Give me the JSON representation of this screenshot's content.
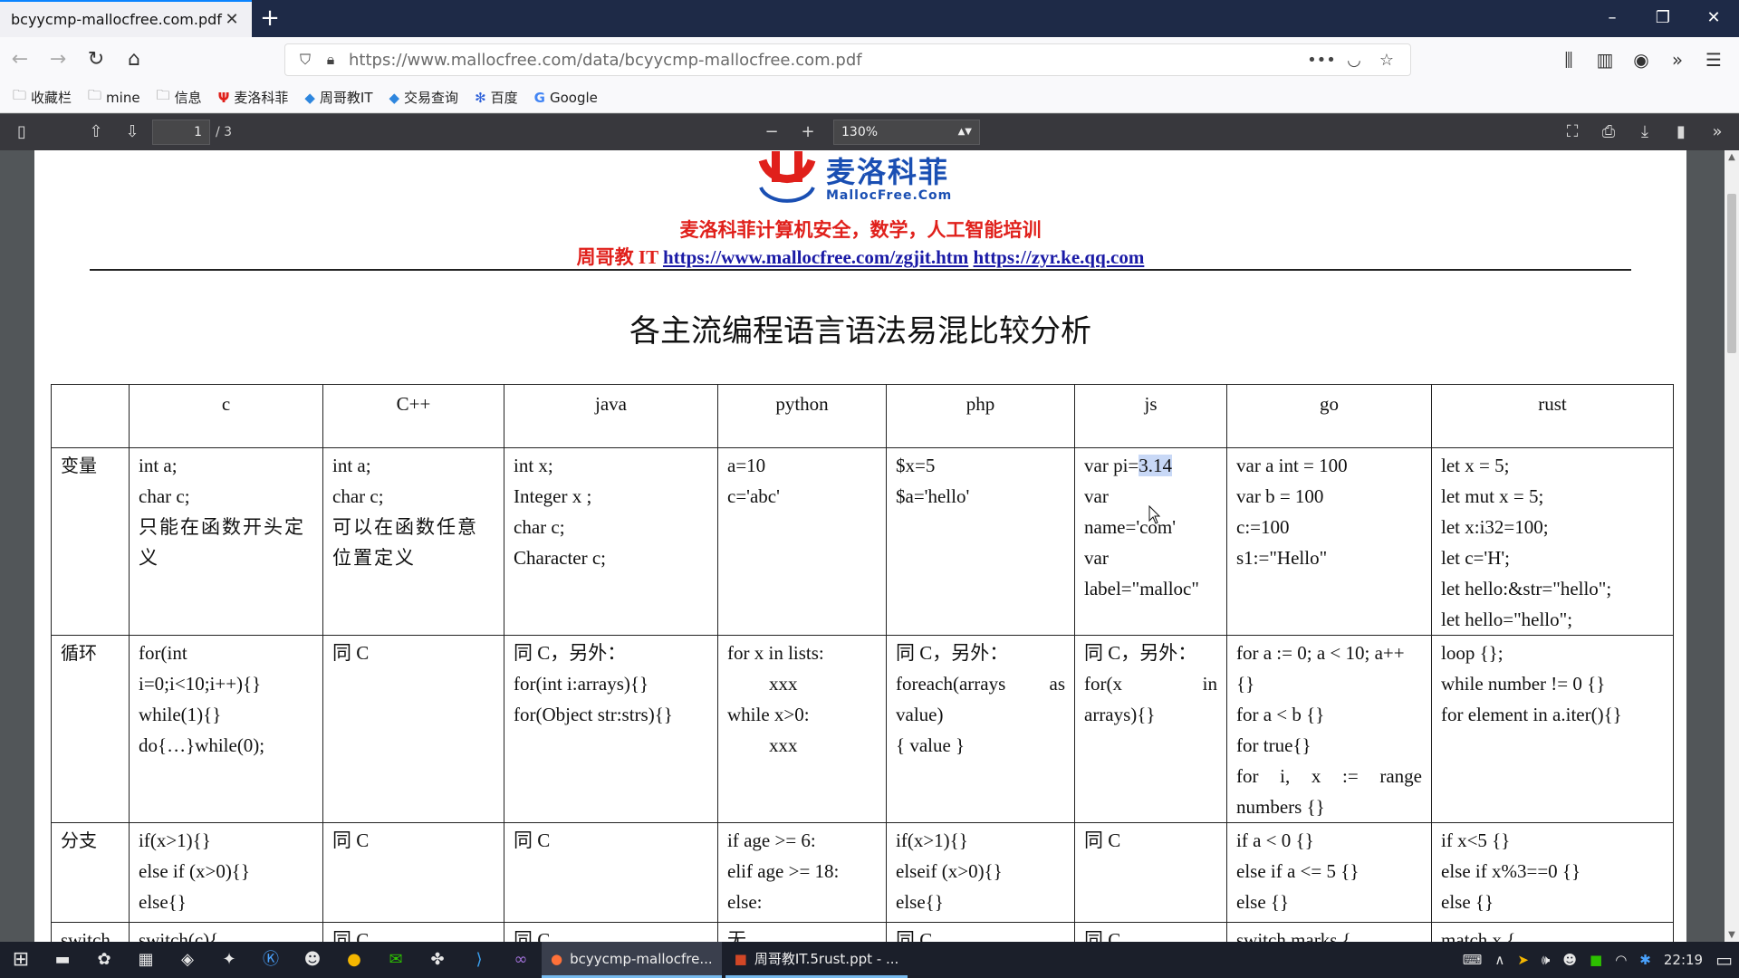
{
  "browser": {
    "tab_title": "bcyycmp-mallocfree.com.pdf",
    "url": "https://www.mallocfree.com/data/bcyycmp-mallocfree.com.pdf"
  },
  "bookmarks": [
    {
      "label": "收藏栏",
      "icon": "folder-icon"
    },
    {
      "label": "mine",
      "icon": "folder-icon"
    },
    {
      "label": "信息",
      "icon": "folder-icon"
    },
    {
      "label": "麦洛科菲",
      "icon": "mallocfree-icon"
    },
    {
      "label": "周哥教IT",
      "icon": "zhouge-icon"
    },
    {
      "label": "交易查询",
      "icon": "trade-icon"
    },
    {
      "label": "百度",
      "icon": "baidu-icon"
    },
    {
      "label": "Google",
      "icon": "google-icon"
    }
  ],
  "pdf_toolbar": {
    "page_current": "1",
    "page_total": "/ 3",
    "zoom": "130%"
  },
  "document": {
    "logo_cn": "麦洛科菲",
    "logo_en": "MallocFree.Com",
    "subtitle": "麦洛科菲计算机安全，数学，人工智能培训",
    "header_prefix": "周哥教 IT",
    "link1": "https://www.mallocfree.com/zgjit.htm",
    "link2": "https://zyr.ke.qq.com",
    "title": "各主流编程语言语法易混比较分析"
  },
  "table": {
    "headers": [
      "",
      "c",
      "C++",
      "java",
      "python",
      "php",
      "js",
      "go",
      "rust"
    ],
    "rows": [
      {
        "label": "变量",
        "cells": [
          [
            "int a;",
            "char c;",
            "只能在函数开头定",
            "义"
          ],
          [
            "int a;",
            "char c;",
            "可以在函数任意",
            "位置定义"
          ],
          [
            "int x;",
            "Integer x ;",
            "char c;",
            "Character c;"
          ],
          [
            "a=10",
            "c='abc'"
          ],
          [
            "$x=5",
            "$a='hello'"
          ],
          [
            "var pi=",
            "var",
            "name='com'",
            "var",
            "label=\"malloc\""
          ],
          [
            "var a int = 100",
            "var b = 100",
            "c:=100",
            "s1:=\"Hello\""
          ],
          [
            "let x = 5;",
            "let mut x = 5;",
            "let x:i32=100;",
            "let c='H';",
            "let hello:&str=\"hello\";",
            "let hello=\"hello\";"
          ]
        ],
        "js_selected": "3.14"
      },
      {
        "label": "循环",
        "cells": [
          [
            "for(int",
            "i=0;i<10;i++){}",
            "while(1){}",
            "do{…}while(0);"
          ],
          [
            "同 C"
          ],
          [
            "同 C，另外：",
            "for(int i:arrays){}",
            "for(Object str:strs){}"
          ],
          [
            "for x in lists:",
            "xxx",
            "while x>0:",
            "xxx"
          ],
          [
            "同 C，另外：",
            "foreach(arrays",
            "as",
            "value)",
            "{ value }"
          ],
          [
            "同 C，另外：",
            "for(x",
            "in",
            "arrays){}"
          ],
          [
            "for a := 0; a < 10; a++",
            "{}",
            "for a < b {}",
            "for true{}",
            "for",
            "i,",
            "x",
            ":=",
            "range",
            "numbers {}"
          ],
          [
            "loop {};",
            "while number != 0 {}",
            "for element in a.iter(){}"
          ]
        ]
      },
      {
        "label": "分支",
        "cells": [
          [
            "if(x>1){}",
            "else if (x>0){}",
            "else{}"
          ],
          [
            "同 C"
          ],
          [
            "同 C"
          ],
          [
            "if age >= 6:",
            "elif age >= 18:",
            "else:"
          ],
          [
            "if(x>1){}",
            "elseif (x>0){}",
            "else{}"
          ],
          [
            "同 C"
          ],
          [
            "if a < 0 {}",
            "else if a <= 5 {}",
            "else {}"
          ],
          [
            "if x<5 {}",
            "else if x%3==0 {}",
            "else {}"
          ]
        ]
      },
      {
        "label": "switch",
        "cells": [
          [
            "switch(c){"
          ],
          [
            "同 C"
          ],
          [
            "同 C"
          ],
          [
            "无"
          ],
          [
            "同 C"
          ],
          [
            "同 C"
          ],
          [
            "switch marks {"
          ],
          [
            "match x {"
          ]
        ]
      }
    ]
  },
  "taskbar": {
    "apps": [
      {
        "label": "bcyycmp-mallocfre...",
        "active": true
      },
      {
        "label": "周哥教IT.5rust.ppt - ...",
        "active": false
      }
    ],
    "clock": "22:19"
  }
}
